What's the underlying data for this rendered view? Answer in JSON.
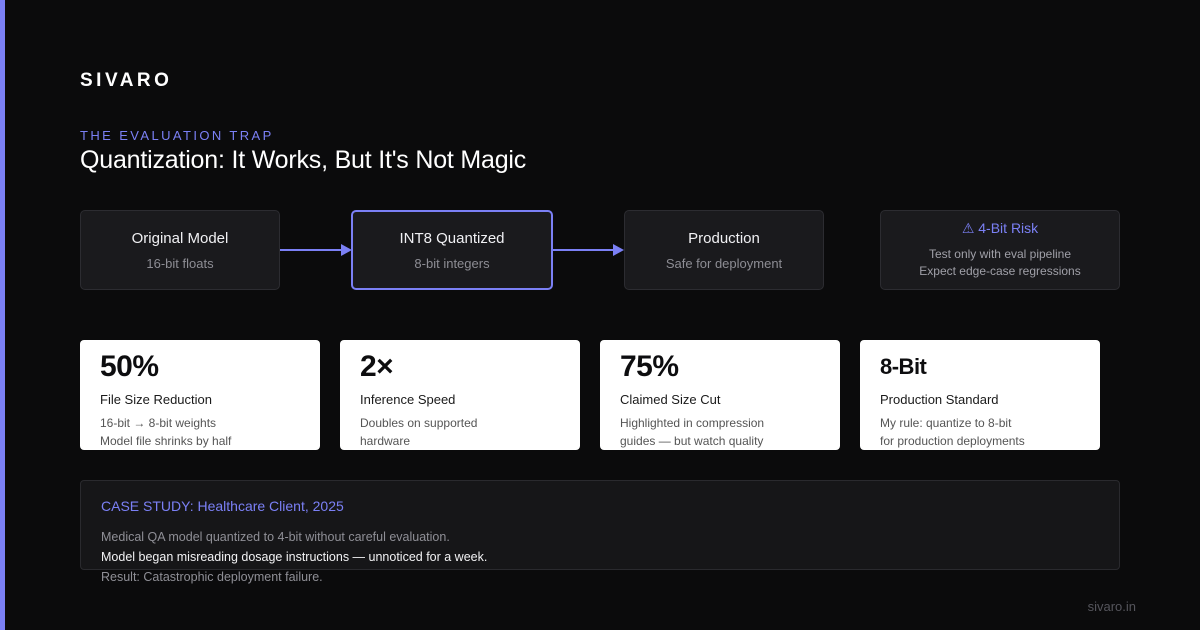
{
  "brand": "SIVARO",
  "eyebrow": "THE EVALUATION TRAP",
  "title": "Quantization: It Works, But It's Not Magic",
  "flow": [
    {
      "name": "Original Model",
      "desc": "16-bit floats"
    },
    {
      "name": "INT8 Quantized",
      "desc": "8-bit integers"
    },
    {
      "name": "Production",
      "desc": "Safe for deployment"
    }
  ],
  "risk": {
    "icon": "warning-icon",
    "name": "⚠ 4-Bit Risk",
    "line1": "Test only with eval pipeline",
    "line2": "Expect edge-case regressions"
  },
  "stats": [
    {
      "value": "50%",
      "label": "File Size Reduction",
      "note1": "16-bit → 8-bit weights",
      "note2": "Model file shrinks by half"
    },
    {
      "value": "2×",
      "label": "Inference Speed",
      "note1": "Doubles on supported",
      "note2": "hardware"
    },
    {
      "value": "75%",
      "label": "Claimed Size Cut",
      "note1": "Highlighted in compression",
      "note2": "guides — but watch quality"
    },
    {
      "value": "8-Bit",
      "label": "Production Standard",
      "note1": "My rule: quantize to 8-bit",
      "note2": "for production deployments"
    }
  ],
  "case_study": {
    "heading": "CASE STUDY: Healthcare Client, 2025",
    "line1": "Medical QA model quantized to 4-bit without careful evaluation.",
    "line2": "Model began misreading dosage instructions — unnoticed for a week.",
    "line3": "Result: Catastrophic deployment failure."
  },
  "footer": "sivaro.in",
  "colors": {
    "accent": "#7b80f5",
    "background": "#0b0b0c",
    "card": "#ffffff"
  }
}
